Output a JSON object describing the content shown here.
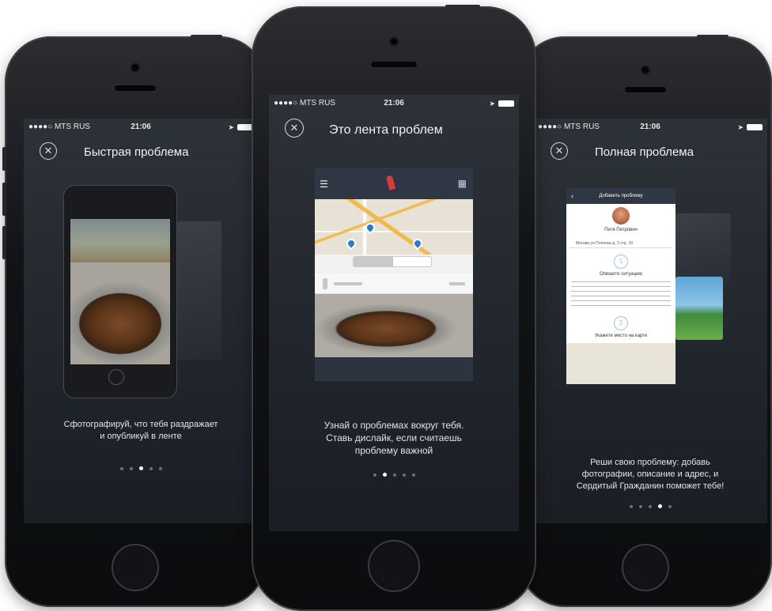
{
  "status_bar": {
    "carrier": "●●●●○ MTS RUS",
    "time": "21:06"
  },
  "screens": [
    {
      "title": "Быстрая проблема",
      "caption_line1": "Сфотографируй, что тебя раздражает",
      "caption_line2": "и опубликуй в ленте",
      "active_dot": 3
    },
    {
      "title": "Это лента проблем",
      "caption_line1": "Узнай о проблемах вокруг тебя.",
      "caption_line2": "Ставь дислайк, если считаешь",
      "caption_line3": "проблему важной",
      "active_dot": 2
    },
    {
      "title": "Полная проблема",
      "caption_line1": "Реши свою проблему: добавь",
      "caption_line2": "фотографии, описание и адрес, и",
      "caption_line3": "Сердитый Гражданин поможет тебе!",
      "active_dot": 4
    }
  ],
  "form_preview": {
    "header": "Добавить проблему",
    "user_name": "Петя Петрович",
    "address": "Москва ул.Полянка д. 3 стр. 10",
    "step1": "Опишите ситуацию",
    "step2": "Укажите место на карте"
  },
  "colors": {
    "screen_bg": "#262a31",
    "accent_pin": "#d93a3a",
    "map_pin": "#2a7ec8"
  }
}
